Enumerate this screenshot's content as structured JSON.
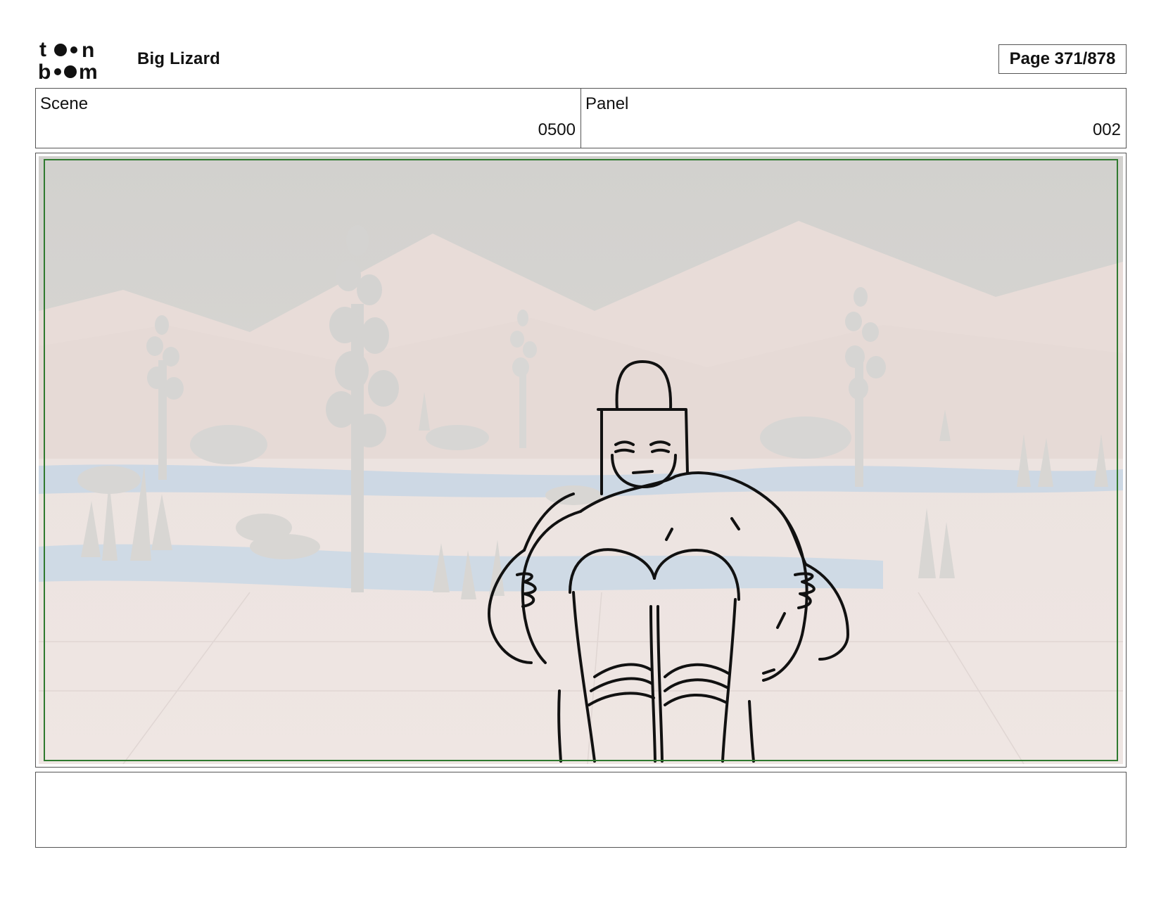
{
  "header": {
    "logo": {
      "name": "toon-boom-logo",
      "line1": "toon",
      "line2": "boom"
    },
    "project_title": "Big Lizard",
    "page_label": "Page 371/878"
  },
  "info": {
    "scene_label": "Scene",
    "scene_value": "0500",
    "panel_label": "Panel",
    "panel_value": "002"
  },
  "panel": {
    "image": "desert-scene-with-sketched-muscular-creature",
    "safe_frame_color": "#2f7a2f"
  },
  "notes": {
    "text": ""
  }
}
